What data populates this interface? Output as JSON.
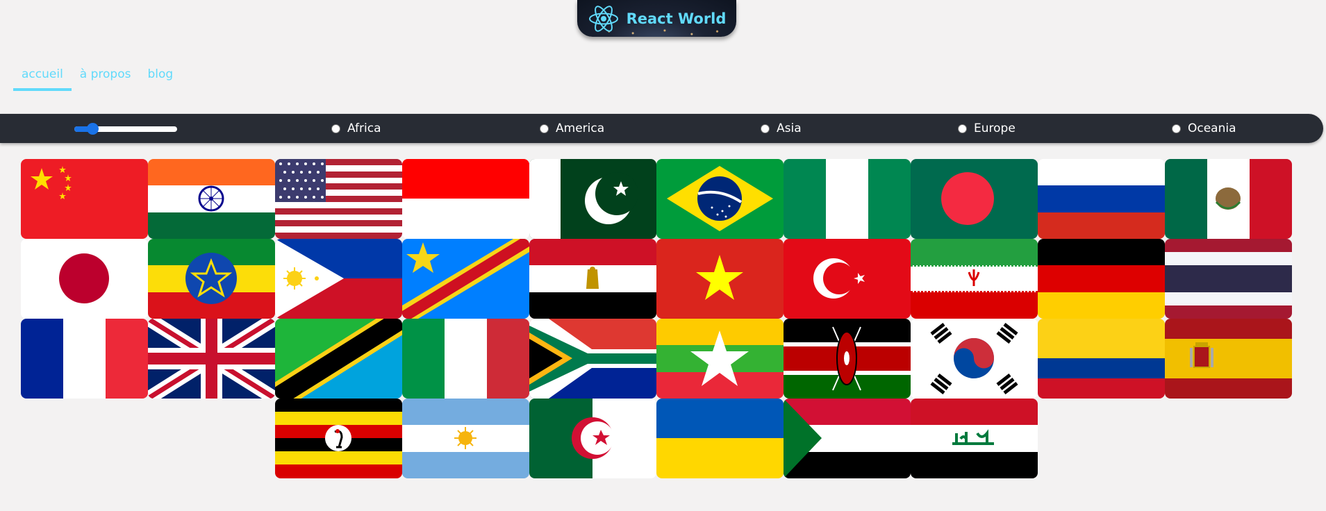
{
  "logo": {
    "text": "React World"
  },
  "nav": {
    "items": [
      "accueil",
      "à propos",
      "blog"
    ],
    "active": 0
  },
  "filters": {
    "slider": {
      "min": 1,
      "max": 250,
      "value": 36
    },
    "regions": [
      "Africa",
      "America",
      "Asia",
      "Europe",
      "Oceania"
    ]
  },
  "flags": [
    {
      "icon": "china-flag-icon",
      "colors": [
        "#ee1c25",
        "#ffde00"
      ]
    },
    {
      "icon": "india-flag-icon",
      "colors": [
        "#ff671f",
        "#ffffff",
        "#046a38",
        "#06038d"
      ]
    },
    {
      "icon": "usa-flag-icon",
      "colors": [
        "#b22234",
        "#ffffff",
        "#3c3b6e"
      ]
    },
    {
      "icon": "indonesia-flag-icon",
      "colors": [
        "#ff0000",
        "#ffffff"
      ]
    },
    {
      "icon": "pakistan-flag-icon",
      "colors": [
        "#01411c",
        "#ffffff"
      ]
    },
    {
      "icon": "brazil-flag-icon",
      "colors": [
        "#009c3b",
        "#ffdf00",
        "#002776"
      ]
    },
    {
      "icon": "nigeria-flag-icon",
      "colors": [
        "#008751",
        "#ffffff"
      ]
    },
    {
      "icon": "bangladesh-flag-icon",
      "colors": [
        "#006a4e",
        "#f42a41"
      ]
    },
    {
      "icon": "russia-flag-icon",
      "colors": [
        "#ffffff",
        "#0039a6",
        "#d52b1e"
      ]
    },
    {
      "icon": "mexico-flag-icon",
      "colors": [
        "#006847",
        "#ffffff",
        "#ce1126"
      ]
    },
    {
      "icon": "japan-flag-icon",
      "colors": [
        "#ffffff",
        "#bc002d"
      ]
    },
    {
      "icon": "ethiopia-flag-icon",
      "colors": [
        "#078930",
        "#fcdd09",
        "#da121a",
        "#0f47af"
      ]
    },
    {
      "icon": "philippines-flag-icon",
      "colors": [
        "#0038a8",
        "#ce1126",
        "#ffffff",
        "#fcd116"
      ]
    },
    {
      "icon": "dr-congo-flag-icon",
      "colors": [
        "#007fff",
        "#f7d618",
        "#ce1021"
      ]
    },
    {
      "icon": "egypt-flag-icon",
      "colors": [
        "#ce1126",
        "#ffffff",
        "#000000",
        "#c09300"
      ]
    },
    {
      "icon": "vietnam-flag-icon",
      "colors": [
        "#da251d",
        "#ffff00"
      ]
    },
    {
      "icon": "turkey-flag-icon",
      "colors": [
        "#e30a17",
        "#ffffff"
      ]
    },
    {
      "icon": "iran-flag-icon",
      "colors": [
        "#239f40",
        "#ffffff",
        "#da0000"
      ]
    },
    {
      "icon": "germany-flag-icon",
      "colors": [
        "#000000",
        "#dd0000",
        "#ffce00"
      ]
    },
    {
      "icon": "thailand-flag-icon",
      "colors": [
        "#a51931",
        "#f4f5f8",
        "#2d2a4a"
      ]
    },
    {
      "icon": "france-flag-icon",
      "colors": [
        "#002395",
        "#ffffff",
        "#ed2939"
      ]
    },
    {
      "icon": "united-kingdom-flag-icon",
      "colors": [
        "#012169",
        "#ffffff",
        "#c8102e"
      ]
    },
    {
      "icon": "tanzania-flag-icon",
      "colors": [
        "#1eb53a",
        "#00a3dd",
        "#fcd116",
        "#000000"
      ]
    },
    {
      "icon": "italy-flag-icon",
      "colors": [
        "#009246",
        "#ffffff",
        "#ce2b37"
      ]
    },
    {
      "icon": "south-africa-flag-icon",
      "colors": [
        "#007a4d",
        "#de3831",
        "#002395",
        "#ffb612",
        "#000000",
        "#ffffff"
      ]
    },
    {
      "icon": "myanmar-flag-icon",
      "colors": [
        "#fecb00",
        "#34b233",
        "#ea2839",
        "#ffffff"
      ]
    },
    {
      "icon": "kenya-flag-icon",
      "colors": [
        "#000000",
        "#bb0000",
        "#006600",
        "#ffffff"
      ]
    },
    {
      "icon": "south-korea-flag-icon",
      "colors": [
        "#ffffff",
        "#cd2e3a",
        "#0047a0",
        "#000000"
      ]
    },
    {
      "icon": "colombia-flag-icon",
      "colors": [
        "#fcd116",
        "#003893",
        "#ce1126"
      ]
    },
    {
      "icon": "spain-flag-icon",
      "colors": [
        "#aa151b",
        "#f1bf00"
      ]
    },
    {
      "icon": "uganda-flag-icon",
      "colors": [
        "#000000",
        "#fcdc04",
        "#d90000",
        "#ffffff"
      ]
    },
    {
      "icon": "argentina-flag-icon",
      "colors": [
        "#74acdf",
        "#ffffff",
        "#f6b40e"
      ]
    },
    {
      "icon": "algeria-flag-icon",
      "colors": [
        "#006233",
        "#ffffff",
        "#d21034"
      ]
    },
    {
      "icon": "ukraine-flag-icon",
      "colors": [
        "#0057b7",
        "#ffd700"
      ]
    },
    {
      "icon": "sudan-flag-icon",
      "colors": [
        "#d21034",
        "#ffffff",
        "#000000",
        "#007229"
      ]
    },
    {
      "icon": "iraq-flag-icon",
      "colors": [
        "#ce1126",
        "#ffffff",
        "#000000",
        "#007a3d"
      ]
    }
  ]
}
